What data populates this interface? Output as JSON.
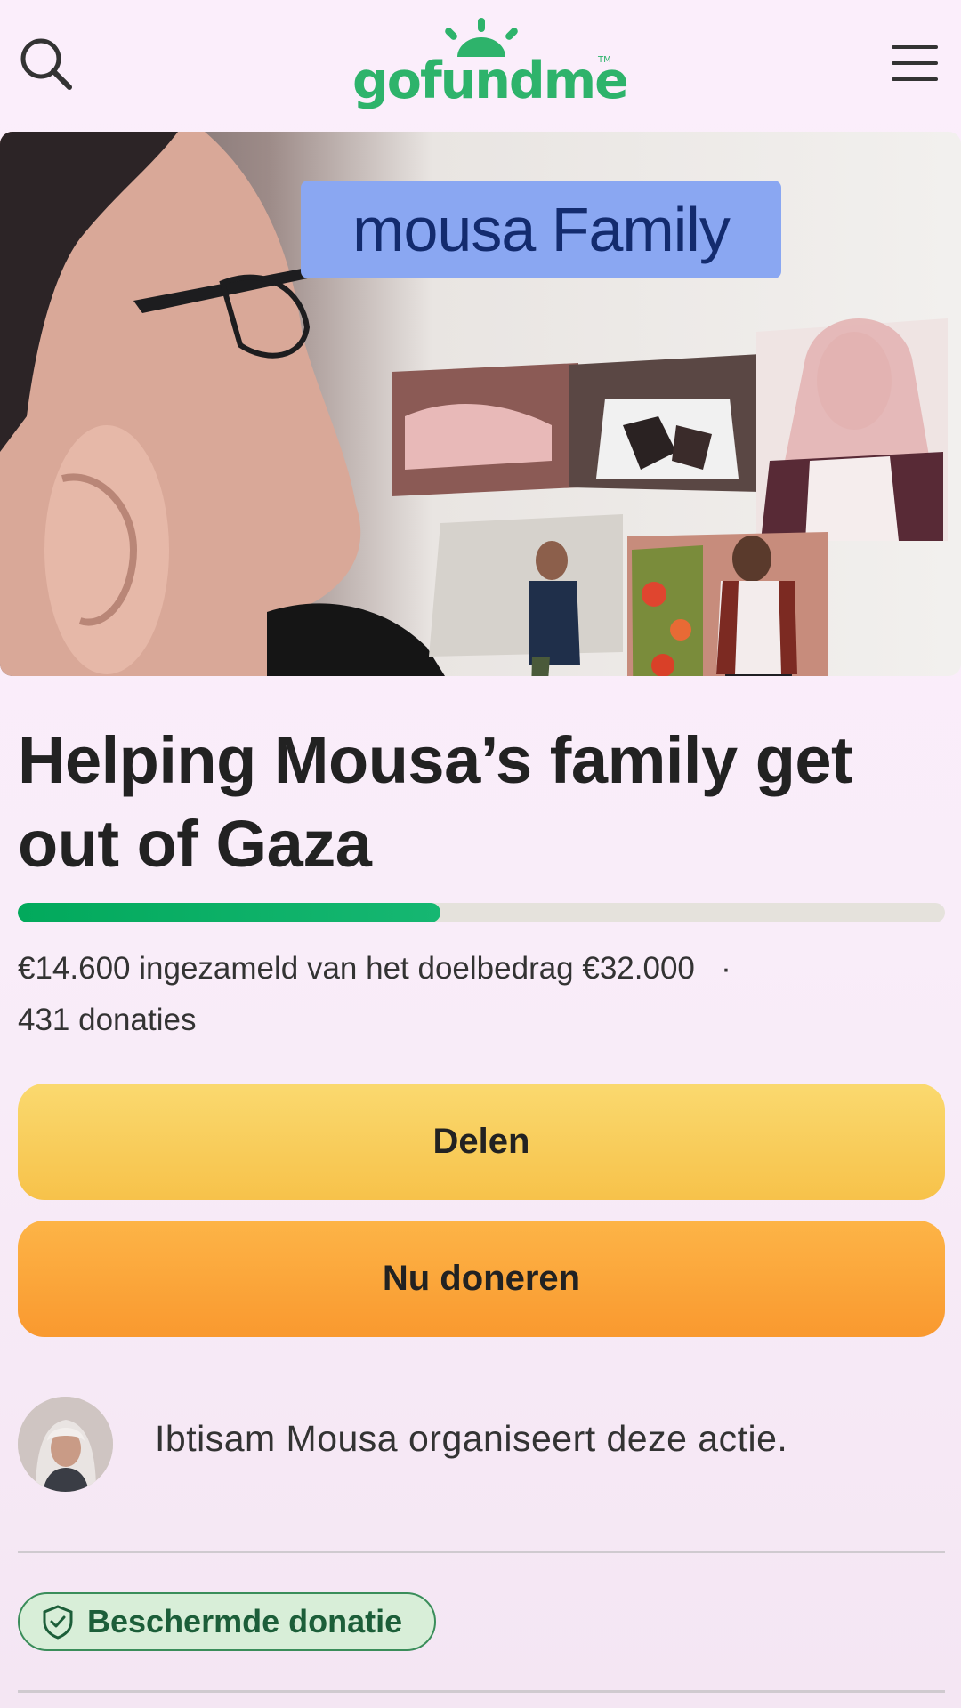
{
  "header": {
    "logo_text": "gofundme",
    "logo_tm": "TM",
    "search_icon": "search-icon",
    "menu_icon": "hamburger-menu-icon"
  },
  "hero": {
    "overlay_label": "mousa Family"
  },
  "campaign": {
    "title": "Helping Mousa’s family get out of Gaza",
    "progress_fraction": 0.456,
    "raised_text": "€14.600 ingezameld van het doelbedrag €32.000",
    "separator": "·",
    "donations_text": "431 donaties"
  },
  "actions": {
    "share_label": "Delen",
    "donate_label": "Nu doneren"
  },
  "organizer": {
    "text": "Ibtisam Mousa organiseert deze actie."
  },
  "protection": {
    "badge_label": "Beschermde donatie",
    "icon": "shield-check-icon"
  },
  "colors": {
    "brand_green": "#02a95c",
    "share_yellow": "#f7c24a",
    "donate_orange": "#f9992f",
    "badge_green": "#1c5e39"
  }
}
